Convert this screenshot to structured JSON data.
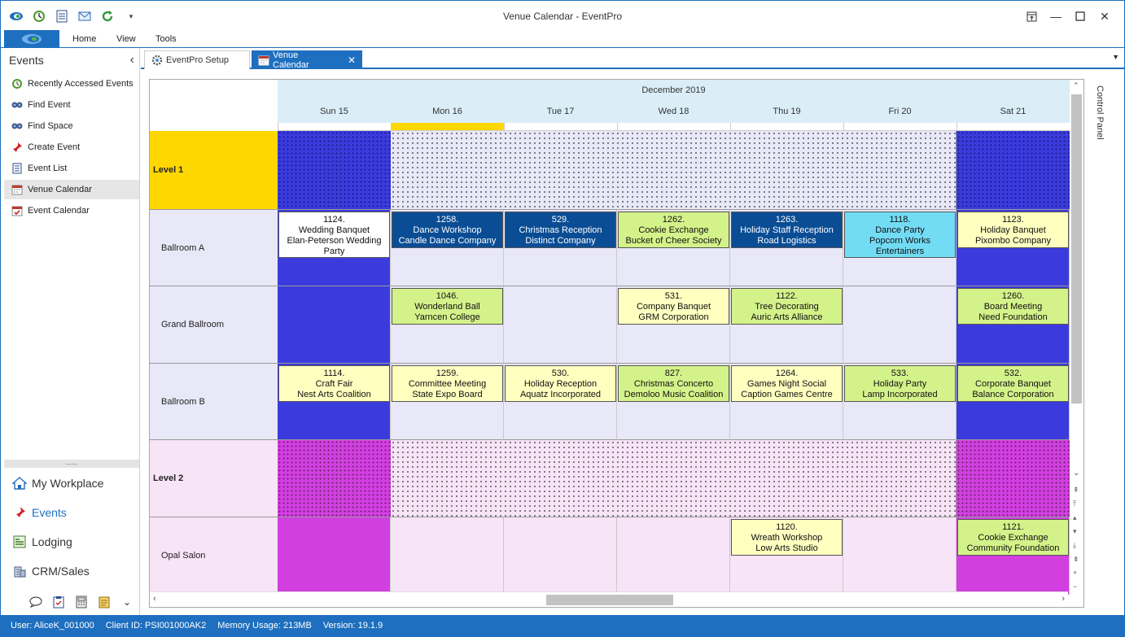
{
  "window": {
    "title": "Venue Calendar - EventPro"
  },
  "ribbon": {
    "tabs": [
      "Home",
      "View",
      "Tools"
    ]
  },
  "sidebar": {
    "header": "Events",
    "items": [
      {
        "label": "Recently Accessed Events",
        "icon": "clock-icon"
      },
      {
        "label": "Find Event",
        "icon": "binoculars-icon"
      },
      {
        "label": "Find Space",
        "icon": "binoculars-icon"
      },
      {
        "label": "Create Event",
        "icon": "pushpin-icon"
      },
      {
        "label": "Event List",
        "icon": "list-document-icon"
      },
      {
        "label": "Venue Calendar",
        "icon": "calendar-icon",
        "selected": true
      },
      {
        "label": "Event Calendar",
        "icon": "calendar-check-icon"
      }
    ],
    "modules": [
      {
        "label": "My Workplace",
        "icon": "house-icon"
      },
      {
        "label": "Events",
        "icon": "pushpin-icon",
        "active": true
      },
      {
        "label": "Lodging",
        "icon": "lodging-icon"
      },
      {
        "label": "CRM/Sales",
        "icon": "building-icon"
      }
    ]
  },
  "doc_tabs": [
    {
      "label": "EventPro Setup",
      "icon": "gear-icon"
    },
    {
      "label": "Venue Calendar",
      "icon": "calendar-icon",
      "active": true
    }
  ],
  "calendar": {
    "month": "December 2019",
    "days": [
      "Sun 15",
      "Mon 16",
      "Tue 17",
      "Wed 18",
      "Thu 19",
      "Fri 20",
      "Sat 21"
    ],
    "today_index": 1,
    "control_panel_label": "Control Panel",
    "rows": [
      {
        "label": "Level 1",
        "kind": "level",
        "color": "#ffd700",
        "weekend_color": "#3b3bdd",
        "weekday_pattern": "dots-blue"
      },
      {
        "label": "Ballroom A",
        "kind": "room",
        "events": [
          {
            "day": 0,
            "lines": [
              "1124.",
              "Wedding Banquet",
              "Elan-Peterson Wedding",
              "Party"
            ],
            "style": "white"
          },
          {
            "day": 1,
            "lines": [
              "1258.",
              "Dance Workshop",
              "Candle Dance Company"
            ],
            "style": "navy"
          },
          {
            "day": 2,
            "lines": [
              "529.",
              "Christmas Reception",
              "Distinct Company"
            ],
            "style": "navy"
          },
          {
            "day": 3,
            "lines": [
              "1262.",
              "Cookie Exchange",
              "Bucket of Cheer Society"
            ],
            "style": "green"
          },
          {
            "day": 4,
            "lines": [
              "1263.",
              "Holiday Staff Reception",
              "Road Logistics"
            ],
            "style": "navy"
          },
          {
            "day": 5,
            "lines": [
              "1118.",
              "Dance Party",
              "Popcorn Works",
              "Entertainers"
            ],
            "style": "cyan"
          },
          {
            "day": 6,
            "lines": [
              "1123.",
              "Holiday Banquet",
              "Pixombo Company"
            ],
            "style": "yellow"
          }
        ]
      },
      {
        "label": "Grand Ballroom",
        "kind": "room",
        "events": [
          {
            "day": 1,
            "lines": [
              "1046.",
              "Wonderland Ball",
              "Yarncen College"
            ],
            "style": "green"
          },
          {
            "day": 3,
            "lines": [
              "531.",
              "Company Banquet",
              "GRM Corporation"
            ],
            "style": "yellow"
          },
          {
            "day": 4,
            "lines": [
              "1122.",
              "Tree Decorating",
              "Auric Arts Alliance"
            ],
            "style": "green"
          },
          {
            "day": 6,
            "lines": [
              "1260.",
              "Board Meeting",
              "Need Foundation"
            ],
            "style": "green"
          }
        ]
      },
      {
        "label": "Ballroom B",
        "kind": "room",
        "events": [
          {
            "day": 0,
            "lines": [
              "1114.",
              "Craft Fair",
              "Nest Arts Coalition"
            ],
            "style": "yellow"
          },
          {
            "day": 1,
            "lines": [
              "1259.",
              "Committee Meeting",
              "State Expo Board"
            ],
            "style": "yellow"
          },
          {
            "day": 2,
            "lines": [
              "530.",
              "Holiday Reception",
              "Aquatz Incorporated"
            ],
            "style": "yellow"
          },
          {
            "day": 3,
            "lines": [
              "827.",
              "Christmas Concerto",
              "Demoloo Music Coalition"
            ],
            "style": "green"
          },
          {
            "day": 4,
            "lines": [
              "1264.",
              "Games Night Social",
              "Caption Games Centre"
            ],
            "style": "yellow"
          },
          {
            "day": 5,
            "lines": [
              "533.",
              "Holiday Party",
              "Lamp Incorporated"
            ],
            "style": "green"
          },
          {
            "day": 6,
            "lines": [
              "532.",
              "Corporate Banquet",
              "Balance Corporation"
            ],
            "style": "green"
          }
        ]
      },
      {
        "label": "Level 2",
        "kind": "level",
        "color": "#f7e4f7",
        "weekend_color": "#d13fe0",
        "weekday_pattern": "dots-pink"
      },
      {
        "label": "Opal Salon",
        "kind": "room2",
        "events": [
          {
            "day": 4,
            "lines": [
              "1120.",
              "Wreath Workshop",
              "Low Arts Studio"
            ],
            "style": "yellow"
          },
          {
            "day": 6,
            "lines": [
              "1121.",
              "Cookie Exchange",
              "Community Foundation"
            ],
            "style": "green"
          }
        ]
      }
    ]
  },
  "colors": {
    "accent": "#1e6fbf",
    "weekday_bg_blue": "#e8e8f8",
    "weekend_blue": "#3b3bdd",
    "weekday_bg_pink": "#f7e4f7",
    "weekend_pink": "#d13fe0",
    "navy": "#0a4d94",
    "green": "#d4f28a",
    "yellow": "#ffffc0",
    "cyan": "#73dcf5",
    "today": "#ffd700"
  },
  "status": {
    "user": "User: AliceK_001000",
    "client": "Client ID: PSI001000AK2",
    "memory": "Memory Usage: 213MB",
    "version": "Version: 19.1.9"
  }
}
